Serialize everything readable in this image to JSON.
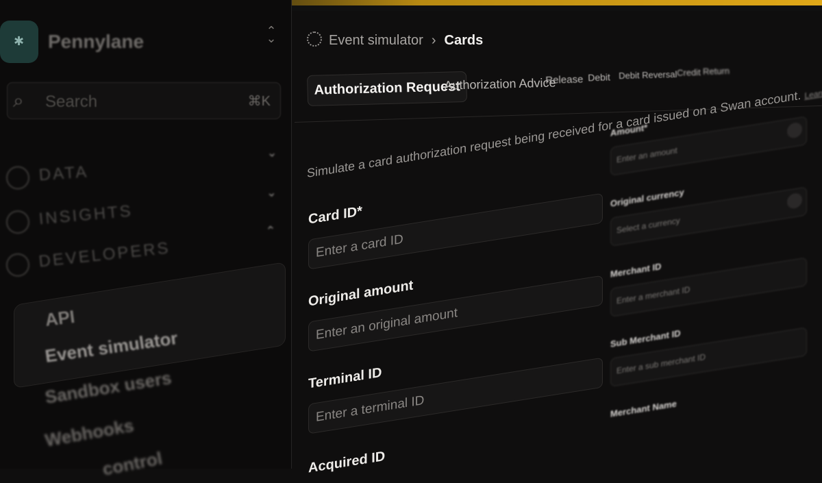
{
  "app": {
    "org_name": "Pennylane",
    "logo_glyph": "✱",
    "accent_color": "#e0a818",
    "logo_color": "#1e3b38"
  },
  "sidebar": {
    "search_placeholder": "Search",
    "search_shortcut": "⌘K",
    "sections": [
      {
        "label": "DATA",
        "expanded": false
      },
      {
        "label": "INSIGHTS",
        "expanded": false
      },
      {
        "label": "DEVELOPERS",
        "expanded": true
      }
    ],
    "items": [
      {
        "label": "API"
      },
      {
        "label": "Event simulator",
        "active": true
      },
      {
        "label": "Sandbox users"
      },
      {
        "label": "Webhooks"
      },
      {
        "label": "control"
      }
    ]
  },
  "breadcrumb": {
    "parent": "Event simulator",
    "current": "Cards"
  },
  "tabs": [
    {
      "label": "Authorization Request",
      "active": true
    },
    {
      "label": "Authorization Advice"
    },
    {
      "label": "Release"
    },
    {
      "label": "Debit"
    },
    {
      "label": "Debit Reversal"
    },
    {
      "label": "Credit"
    },
    {
      "label": "Return"
    }
  ],
  "form": {
    "description": "Simulate a card authorization request being received for a card issued on a Swan account.",
    "description_link": "Learn more",
    "fields": [
      {
        "label": "Card ID*",
        "placeholder": "Enter a card ID"
      },
      {
        "label": "Original amount",
        "placeholder": "Enter an original amount"
      },
      {
        "label": "Terminal ID",
        "placeholder": "Enter a terminal ID"
      },
      {
        "label": "Acquired ID"
      }
    ],
    "right_fields": [
      {
        "label": "Amount*",
        "placeholder": "Enter an amount"
      },
      {
        "label": "Original currency",
        "placeholder": "Select a currency"
      },
      {
        "label": "Merchant ID",
        "placeholder": "Enter a merchant ID"
      },
      {
        "label": "Sub Merchant ID",
        "placeholder": "Enter a sub merchant ID"
      },
      {
        "label": "Merchant Name"
      }
    ]
  }
}
